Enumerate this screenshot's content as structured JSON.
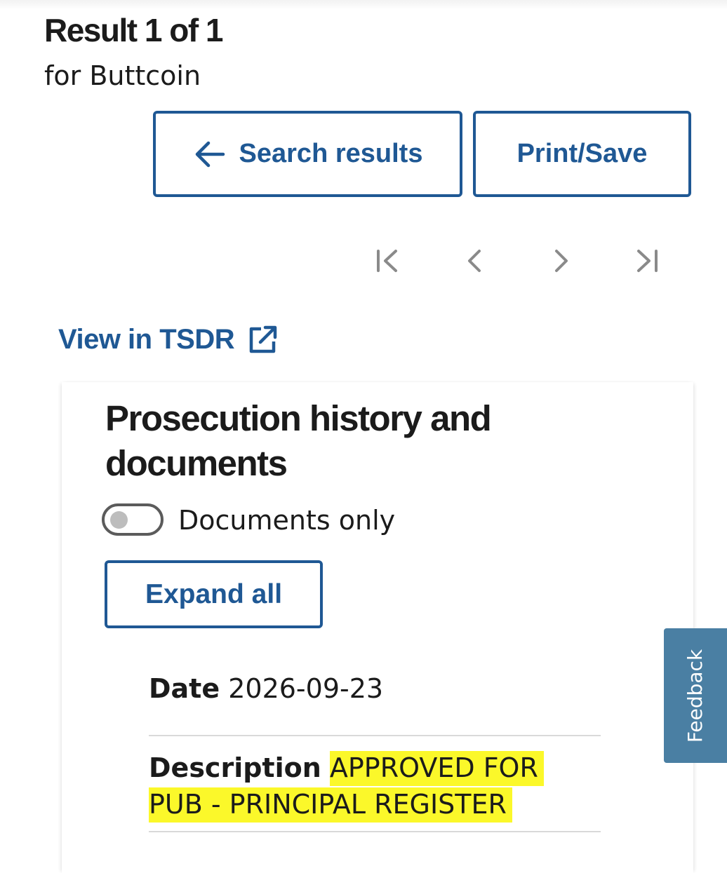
{
  "header": {
    "result_title": "Result 1 of 1",
    "result_subtitle": "for Buttcoin"
  },
  "toolbar": {
    "search_results_label": "Search results",
    "search_results_icon": "arrow-left-icon",
    "print_save_label": "Print/Save"
  },
  "pagination": {
    "icons": [
      "first-page-icon",
      "previous-page-icon",
      "next-page-icon",
      "last-page-icon"
    ]
  },
  "tsdr_link": {
    "label": "View in TSDR",
    "icon": "external-link-icon"
  },
  "prosecution": {
    "heading": "Prosecution history and documents",
    "toggle_label": "Documents only",
    "toggle_on": false,
    "expand_label": "Expand all",
    "date_label": "Date",
    "date_value": "2026-09-23",
    "description_label": "Description",
    "description_value": "APPROVED FOR PUB - PRINCIPAL REGISTER",
    "highlight_color": "#fbf82a"
  },
  "feedback": {
    "label": "Feedback"
  },
  "colors": {
    "accent": "#1f5894",
    "feedback_bg": "#4a7fa3",
    "text": "#1b1b1b",
    "disabled_icon": "#8a8a8a"
  }
}
